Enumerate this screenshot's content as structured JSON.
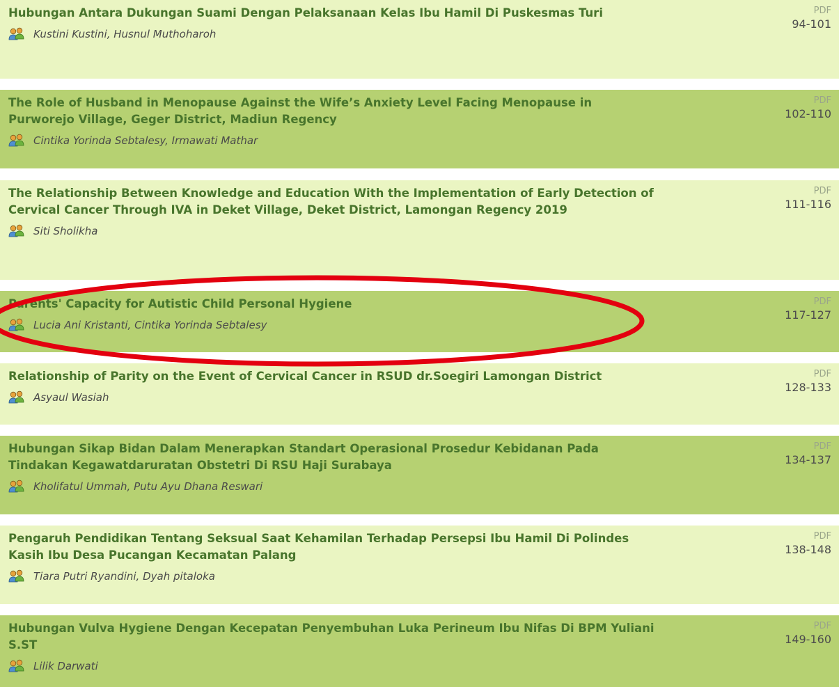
{
  "articles": [
    {
      "title": "Hubungan Antara Dukungan Suami Dengan Pelaksanaan Kelas Ibu Hamil Di Puskesmas Turi",
      "authors": "Kustini Kustini, Husnul Muthoharoh",
      "pdf_label": "PDF",
      "pages": "94-101"
    },
    {
      "title": "The Role of Husband in Menopause Against the Wife’s Anxiety Level Facing Menopause in Purworejo Village, Geger District, Madiun Regency",
      "authors": "Cintika Yorinda Sebtalesy, Irmawati Mathar",
      "pdf_label": "PDF",
      "pages": "102-110"
    },
    {
      "title": "The Relationship Between Knowledge and Education With the Implementation of Early Detection of Cervical Cancer Through IVA in Deket Village, Deket District, Lamongan Regency 2019",
      "authors": "Siti Sholikha",
      "pdf_label": "PDF",
      "pages": "111-116"
    },
    {
      "title": "Parents' Capacity for Autistic Child Personal Hygiene",
      "authors": "Lucia Ani Kristanti, Cintika Yorinda Sebtalesy",
      "pdf_label": "PDF",
      "pages": "117-127"
    },
    {
      "title": "Relationship of Parity on the Event of Cervical Cancer in RSUD dr.Soegiri Lamongan District",
      "authors": "Asyaul Wasiah",
      "pdf_label": "PDF",
      "pages": "128-133"
    },
    {
      "title": "Hubungan Sikap Bidan Dalam Menerapkan Standart Operasional Prosedur Kebidanan Pada Tindakan Kegawatdaruratan Obstetri Di RSU Haji Surabaya",
      "authors": "Kholifatul Ummah, Putu Ayu Dhana Reswari",
      "pdf_label": "PDF",
      "pages": "134-137"
    },
    {
      "title": "Pengaruh Pendidikan Tentang Seksual Saat Kehamilan Terhadap Persepsi Ibu Hamil Di Polindes Kasih Ibu Desa Pucangan Kecamatan Palang",
      "authors": "Tiara Putri Ryandini, Dyah pitaloka",
      "pdf_label": "PDF",
      "pages": "138-148"
    },
    {
      "title": "Hubungan Vulva Hygiene Dengan Kecepatan Penyembuhan Luka Perineum Ibu Nifas Di BPM Yuliani S.ST",
      "authors": "Lilik Darwati",
      "pdf_label": "PDF",
      "pages": "149-160"
    }
  ],
  "colors": {
    "row_light": "#eaf5c2",
    "row_dark": "#b6d172",
    "title": "#48752c",
    "highlight_ellipse": "#e3000f"
  },
  "icons": {
    "authors": "users-icon"
  }
}
